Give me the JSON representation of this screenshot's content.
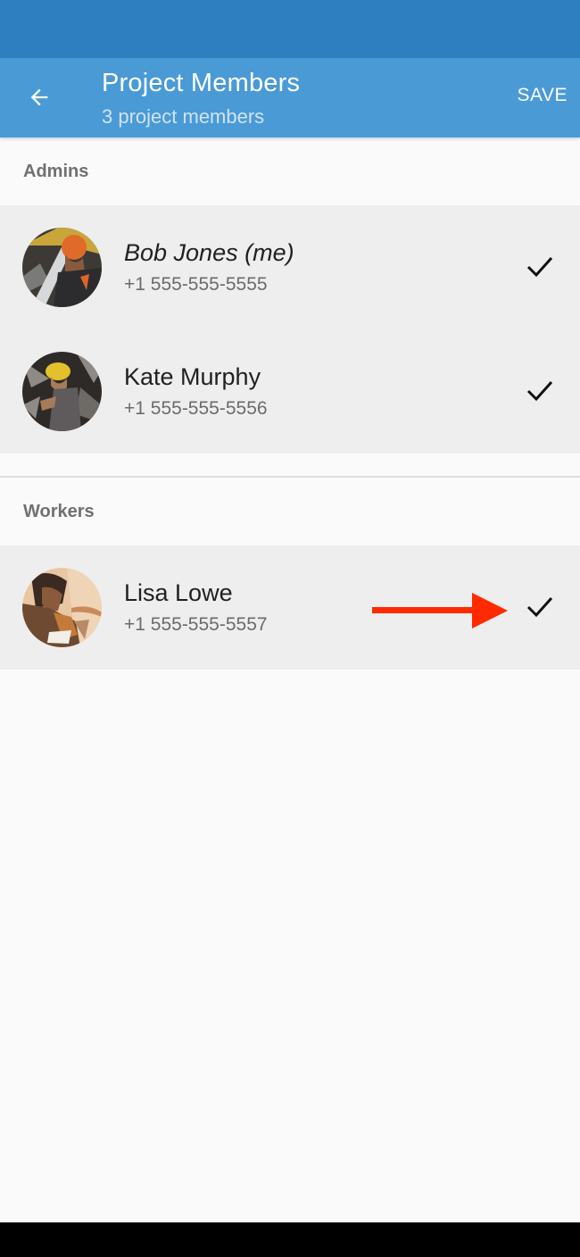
{
  "app_bar": {
    "title": "Project Members",
    "subtitle": "3 project members",
    "back_icon": "arrow-left-icon",
    "save_label": "SAVE"
  },
  "colors": {
    "status_bar": "#2d7fbf",
    "app_bar": "#4a9ad6",
    "list_background": "#eeeeee",
    "page_background": "#fafafa",
    "annotation_arrow": "#ff2a00"
  },
  "sections": [
    {
      "header": "Admins",
      "members": [
        {
          "name": "Bob Jones (me)",
          "phone": "+1 555-555-5555",
          "selected": true,
          "is_self": true,
          "avatar": "worker-orange-hardhat-photo"
        },
        {
          "name": "Kate Murphy",
          "phone": "+1 555-555-5556",
          "selected": true,
          "is_self": false,
          "avatar": "worker-yellow-hardhat-photo"
        }
      ]
    },
    {
      "header": "Workers",
      "members": [
        {
          "name": "Lisa Lowe",
          "phone": "+1 555-555-5557",
          "selected": true,
          "is_self": false,
          "avatar": "woman-working-photo"
        }
      ]
    }
  ],
  "annotation": {
    "type": "arrow",
    "icon": "red-arrow-right-icon",
    "points_to": "Lisa Lowe checkmark"
  }
}
